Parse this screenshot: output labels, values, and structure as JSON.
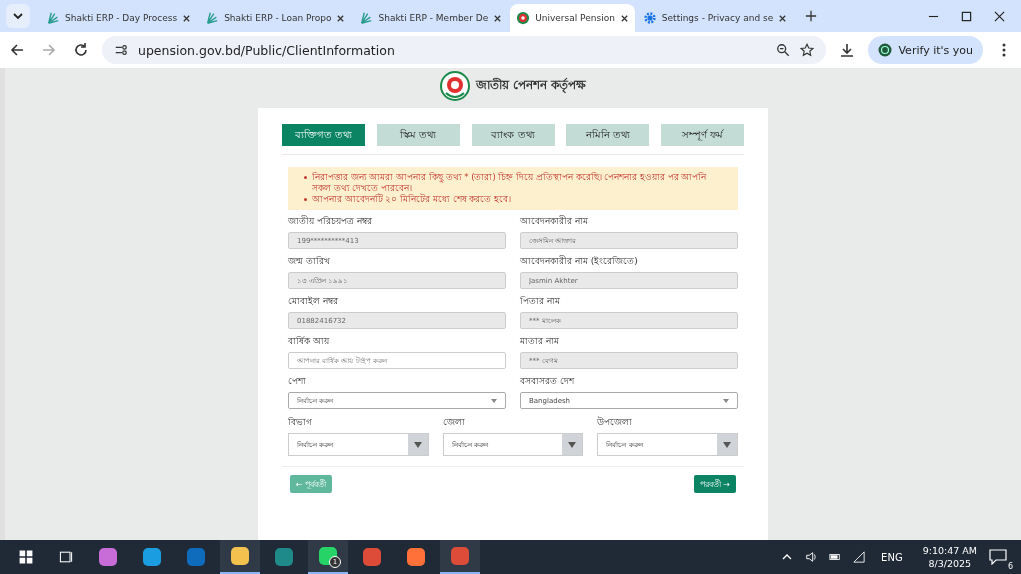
{
  "browser": {
    "tabs": [
      {
        "title": "Shakti ERP - Day Process",
        "selected": false,
        "kind": "erp"
      },
      {
        "title": "Shakti ERP - Loan Propo",
        "selected": false,
        "kind": "erp"
      },
      {
        "title": "Shakti ERP - Member De",
        "selected": false,
        "kind": "erp"
      },
      {
        "title": "Universal Pension",
        "selected": true,
        "kind": "site"
      },
      {
        "title": "Settings - Privacy and se",
        "selected": false,
        "kind": "settings"
      }
    ],
    "url": "upension.gov.bd/Public/ClientInformation",
    "profile_button": "Verify it's you"
  },
  "page": {
    "org_name": "জাতীয় পেনশন কর্তৃপক্ষ",
    "steps": [
      {
        "label": "ব্যক্তিগত তথ্য",
        "selected": true
      },
      {
        "label": "স্কিম তথ্য",
        "selected": false
      },
      {
        "label": "ব্যাংক তথ্য",
        "selected": false
      },
      {
        "label": "নমিনি তথ্য",
        "selected": false
      },
      {
        "label": "সম্পূর্ণ ফর্ম",
        "selected": false
      }
    ],
    "notices": [
      "নিরাপত্তার জন্য আমরা আপনার কিছু তথ্য * (তারা) চিহ্ন দিয়ে প্রতিস্থাপন করেছি। পেনশনার হওয়ার পর আপনি সকল তথ্য দেখতে পারবেন।",
      "আপনার আবেদনটি ২০ মিনিটের মধ্যে শেষ করতে হবে।"
    ],
    "fields": [
      {
        "label": "জাতীয় পরিচয়পত্র নম্বর",
        "kind": "text",
        "value": "199**********413",
        "disabled": true
      },
      {
        "label": "আবেদনকারীর নাম",
        "kind": "text",
        "value": "জেসমিন আক্তার",
        "disabled": true
      },
      {
        "label": "জন্ম তারিখ",
        "kind": "text",
        "value": "১৩ এপ্রিল ১৯৯১",
        "disabled": true
      },
      {
        "label": "আবেদনকারীর নাম (ইংরেজিতে)",
        "kind": "text",
        "value": "Jasmin Akhter",
        "disabled": true
      },
      {
        "label": "মোবাইল নম্বর",
        "kind": "text",
        "value": "01882416732",
        "disabled": true
      },
      {
        "label": "পিতার নাম",
        "kind": "text",
        "value": "*** মালেক",
        "disabled": true
      },
      {
        "label": "বার্ষিক আয়",
        "kind": "text",
        "placeholder": "আপনার বার্ষিক আয় টাইপ করুন",
        "disabled": false
      },
      {
        "label": "মাতার নাম",
        "kind": "text",
        "value": "*** বেগম",
        "disabled": true
      },
      {
        "label": "পেশা",
        "kind": "select",
        "value": "নির্বাচন করুন",
        "disabled": false
      },
      {
        "label": "বসবাসরত দেশ",
        "kind": "select",
        "value": "Bangladesh",
        "disabled": false
      }
    ],
    "address_fields": [
      {
        "label": "বিভাগ",
        "kind": "dropdown",
        "value": "নির্বাচন করুন"
      },
      {
        "label": "জেলা",
        "kind": "dropdown",
        "value": "নির্বাচন করুন"
      },
      {
        "label": "উপজেলা",
        "kind": "dropdown",
        "value": "নির্বাচন করুন"
      }
    ],
    "prev_button": "← পূর্ববর্তী",
    "next_button": "পরবর্তী →"
  },
  "taskbar": {
    "apps": [
      {
        "running": false
      },
      {
        "running": false
      },
      {
        "running": false
      },
      {
        "running": true
      },
      {
        "running": false
      },
      {
        "running": true,
        "badge": "1"
      },
      {
        "running": false
      },
      {
        "running": false
      },
      {
        "running": true
      }
    ],
    "language": "ENG",
    "time": "9:10:47 AM",
    "date": "8/3/2025",
    "notifications": "6"
  }
}
